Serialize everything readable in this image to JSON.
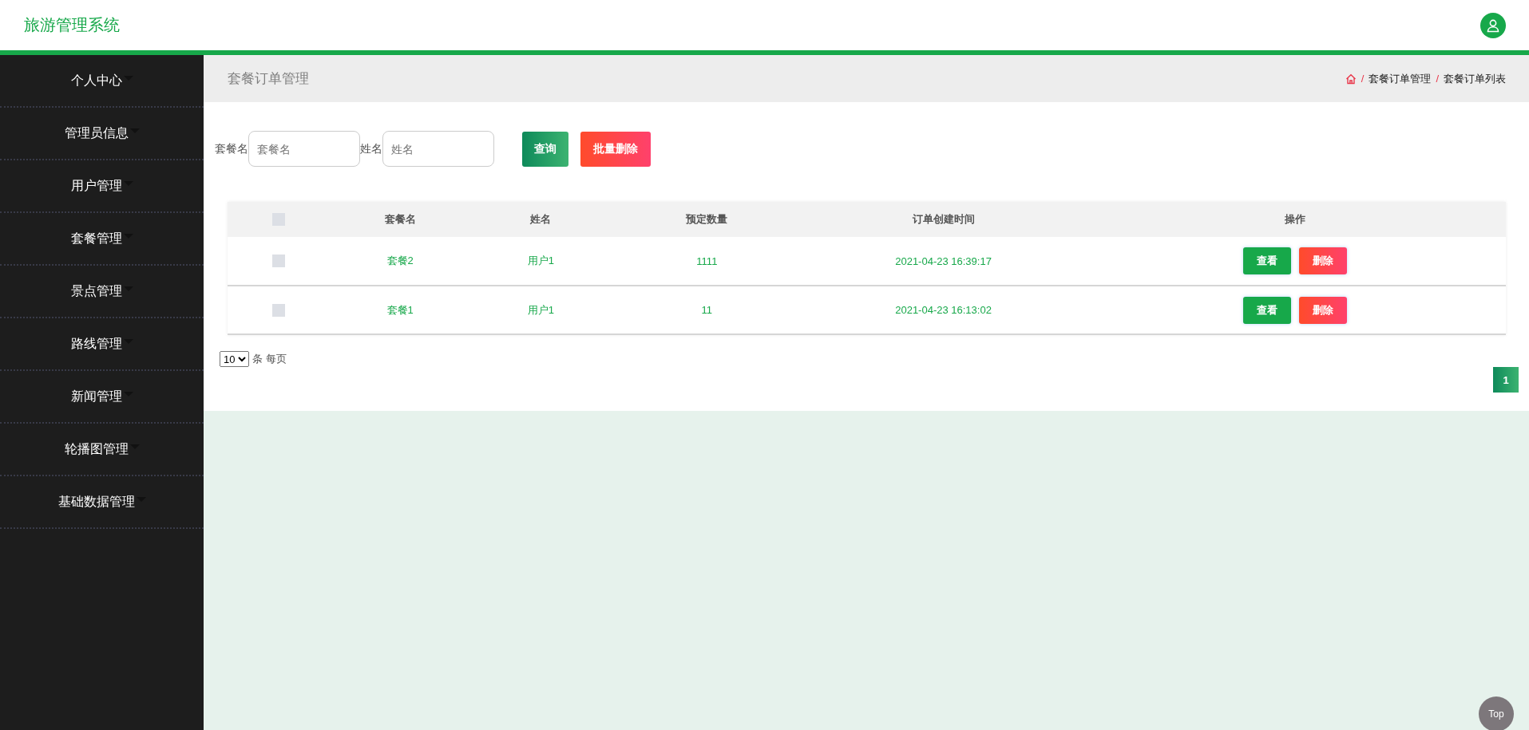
{
  "header": {
    "title": "旅游管理系统"
  },
  "sidebar": {
    "items": [
      {
        "label": "个人中心"
      },
      {
        "label": "管理员信息"
      },
      {
        "label": "用户管理"
      },
      {
        "label": "套餐管理"
      },
      {
        "label": "景点管理"
      },
      {
        "label": "路线管理"
      },
      {
        "label": "新闻管理"
      },
      {
        "label": "轮播图管理"
      },
      {
        "label": "基础数据管理"
      }
    ]
  },
  "page_title": "套餐订单管理",
  "breadcrumb": [
    {
      "separator": "/",
      "label": "套餐订单管理"
    },
    {
      "separator": "/",
      "label": "套餐订单列表"
    }
  ],
  "search": {
    "fields": [
      {
        "label": "套餐名",
        "placeholder": "套餐名"
      },
      {
        "label": "姓名",
        "placeholder": "姓名"
      }
    ],
    "buttons": [
      {
        "kind": "query",
        "label": "查询"
      },
      {
        "kind": "batch_delete",
        "label": "批量删除"
      }
    ]
  },
  "table": {
    "header_checked": false,
    "columns": [
      "套餐名",
      "姓名",
      "预定数量",
      "订单创建时间",
      "操作"
    ],
    "rows": [
      {
        "checked": false,
        "cells": [
          "套餐2",
          "用户1",
          "1111",
          "2021-04-23 16:39:17"
        ],
        "actions": [
          "查看",
          "删除"
        ]
      },
      {
        "checked": false,
        "cells": [
          "套餐1",
          "用户1",
          "11",
          "2021-04-23 16:13:02"
        ],
        "actions": [
          "查看",
          "删除"
        ]
      }
    ]
  },
  "page_size": {
    "value": "10",
    "label": "条 每页"
  },
  "pagination": [
    {
      "label": "1",
      "selected": true
    }
  ],
  "top_button": "Top"
}
